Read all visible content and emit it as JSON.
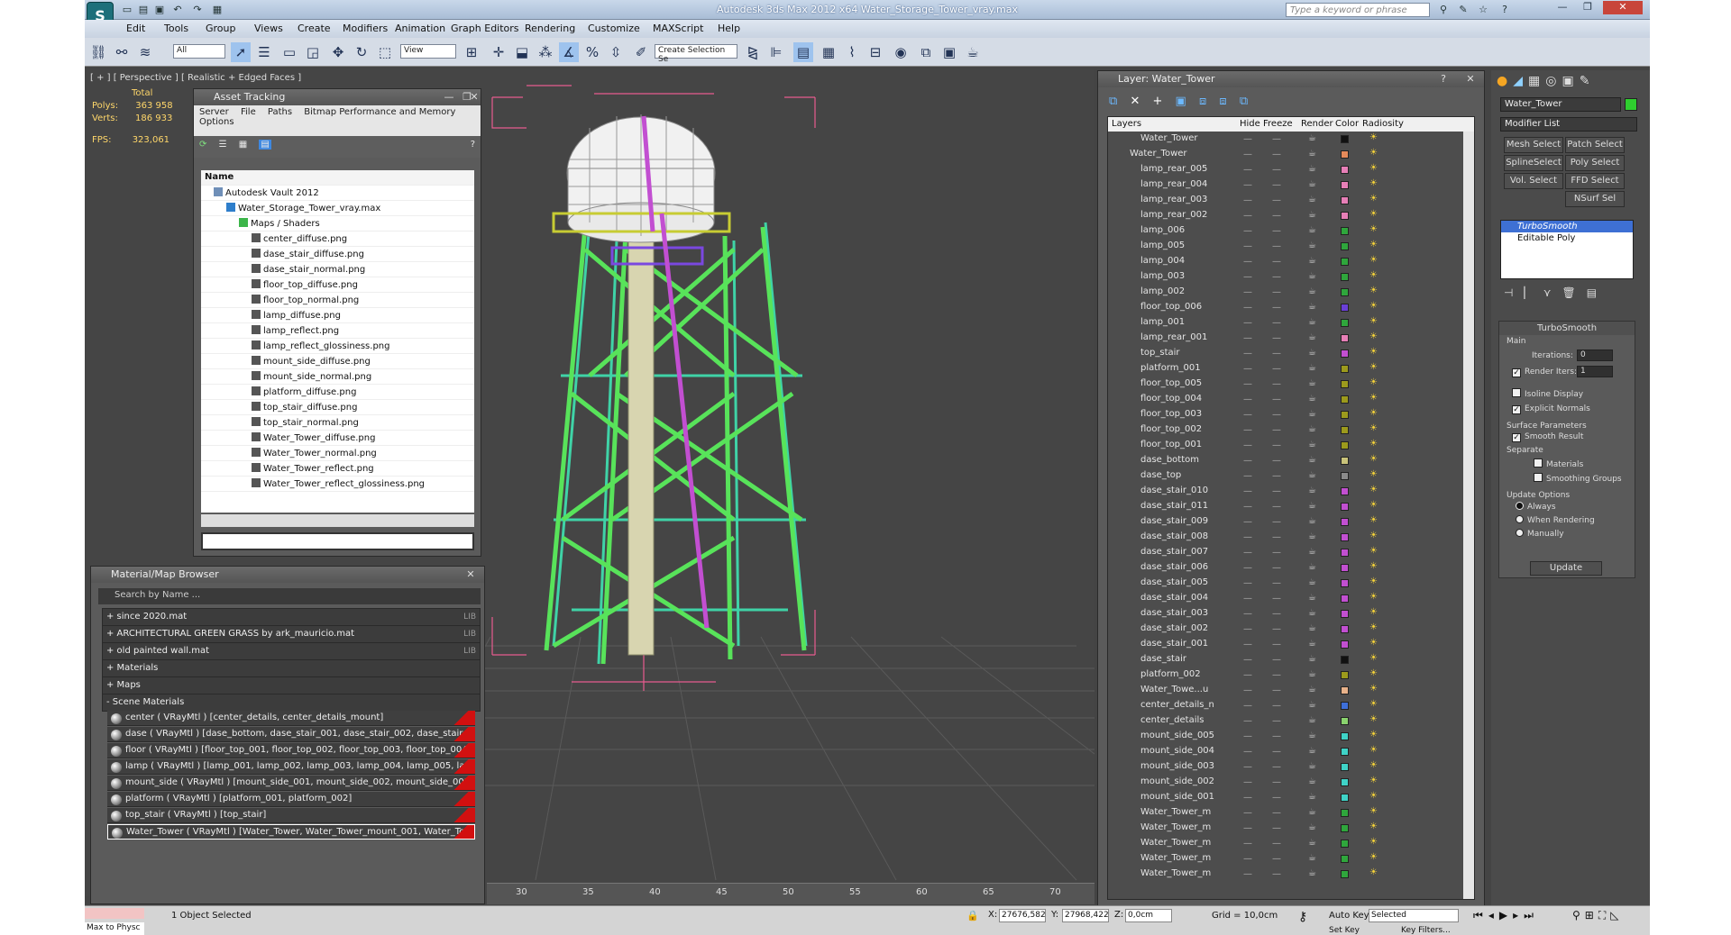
{
  "app": {
    "title": "Autodesk 3ds Max  2012 x64     Water_Storage_Tower_vray.max",
    "search_placeholder": "Type a keyword or phrase"
  },
  "menu": [
    "Edit",
    "Tools",
    "Group",
    "Views",
    "Create",
    "Modifiers",
    "Animation",
    "Graph Editors",
    "Rendering",
    "Customize",
    "MAXScript",
    "Help"
  ],
  "toolbar": {
    "selection_filter": "All",
    "ref_coord": "View",
    "named_selection": "Create Selection Se"
  },
  "viewport": {
    "label": "[ + ] [ Perspective ] [ Realistic + Edged Faces ]",
    "total": "Total",
    "polys_label": "Polys:",
    "polys": "363 958",
    "verts_label": "Verts:",
    "verts": "186 933",
    "fps_label": "FPS:",
    "fps": "323,061"
  },
  "asset_tracking": {
    "title": "Asset Tracking",
    "menu": [
      "Server",
      "File",
      "Paths",
      "Bitmap Performance and Memory",
      "Options"
    ],
    "col": "Name",
    "tree": [
      {
        "name": "Autodesk Vault 2012",
        "indent": 1,
        "type": "vault"
      },
      {
        "name": "Water_Storage_Tower_vray.max",
        "indent": 2,
        "type": "max"
      },
      {
        "name": "Maps / Shaders",
        "indent": 3,
        "type": "folder"
      },
      {
        "name": "center_diffuse.png",
        "indent": 4,
        "type": "file"
      },
      {
        "name": "dase_stair_diffuse.png",
        "indent": 4,
        "type": "file"
      },
      {
        "name": "dase_stair_normal.png",
        "indent": 4,
        "type": "file"
      },
      {
        "name": "floor_top_diffuse.png",
        "indent": 4,
        "type": "file"
      },
      {
        "name": "floor_top_normal.png",
        "indent": 4,
        "type": "file"
      },
      {
        "name": "lamp_diffuse.png",
        "indent": 4,
        "type": "file"
      },
      {
        "name": "lamp_reflect.png",
        "indent": 4,
        "type": "file"
      },
      {
        "name": "lamp_reflect_glossiness.png",
        "indent": 4,
        "type": "file"
      },
      {
        "name": "mount_side_diffuse.png",
        "indent": 4,
        "type": "file"
      },
      {
        "name": "mount_side_normal.png",
        "indent": 4,
        "type": "file"
      },
      {
        "name": "platform_diffuse.png",
        "indent": 4,
        "type": "file"
      },
      {
        "name": "top_stair_diffuse.png",
        "indent": 4,
        "type": "file"
      },
      {
        "name": "top_stair_normal.png",
        "indent": 4,
        "type": "file"
      },
      {
        "name": "Water_Tower_diffuse.png",
        "indent": 4,
        "type": "file"
      },
      {
        "name": "Water_Tower_normal.png",
        "indent": 4,
        "type": "file"
      },
      {
        "name": "Water_Tower_reflect.png",
        "indent": 4,
        "type": "file"
      },
      {
        "name": "Water_Tower_reflect_glossiness.png",
        "indent": 4,
        "type": "file"
      }
    ]
  },
  "material_browser": {
    "title": "Material/Map Browser",
    "search_placeholder": "Search by Name ...",
    "libs": [
      {
        "name": "+ since 2020.mat",
        "tag": "LIB"
      },
      {
        "name": "+ ARCHITECTURAL GREEN GRASS by ark_mauricio.mat",
        "tag": "LIB"
      },
      {
        "name": "+ old painted wall.mat",
        "tag": "LIB"
      },
      {
        "name": "+ Materials",
        "tag": ""
      },
      {
        "name": "+ Maps",
        "tag": ""
      },
      {
        "name": "- Scene Materials",
        "tag": ""
      }
    ],
    "materials": [
      "center  ( VRayMtl ) [center_details, center_details_mount]",
      "dase  ( VRayMtl ) [dase_bottom, dase_stair_001, dase_stair_002, dase_stair_00...",
      "floor  ( VRayMtl ) [floor_top_001, floor_top_002, floor_top_003, floor_top_004, f...",
      "lamp  ( VRayMtl ) [lamp_001, lamp_002, lamp_003, lamp_004, lamp_005, lamp...",
      "mount_side  ( VRayMtl ) [mount_side_001, mount_side_002, mount_side_003,...",
      "platform  ( VRayMtl ) [platform_001, platform_002]",
      "top_stair  ( VRayMtl ) [top_stair]",
      "Water_Tower  ( VRayMtl ) [Water_Tower, Water_Tower_mount_001, Water_To..."
    ]
  },
  "layers": {
    "title": "Layer: Water_Tower",
    "cols": [
      "Layers",
      "Hide",
      "Freeze",
      "Render",
      "Color",
      "Radiosity"
    ],
    "rows": [
      {
        "name": "Water_Tower",
        "color": "#111111",
        "level": 1
      },
      {
        "name": "Water_Tower",
        "color": "#e58a5a",
        "level": 0
      },
      {
        "name": "lamp_rear_005",
        "color": "#e77fb7",
        "level": 1
      },
      {
        "name": "lamp_rear_004",
        "color": "#e77fb7",
        "level": 1
      },
      {
        "name": "lamp_rear_003",
        "color": "#e77fb7",
        "level": 1
      },
      {
        "name": "lamp_rear_002",
        "color": "#e77fb7",
        "level": 1
      },
      {
        "name": "lamp_006",
        "color": "#2fa63c",
        "level": 1
      },
      {
        "name": "lamp_005",
        "color": "#2fa63c",
        "level": 1
      },
      {
        "name": "lamp_004",
        "color": "#2fa63c",
        "level": 1
      },
      {
        "name": "lamp_003",
        "color": "#2fa63c",
        "level": 1
      },
      {
        "name": "lamp_002",
        "color": "#2fa63c",
        "level": 1
      },
      {
        "name": "floor_top_006",
        "color": "#6a3fd6",
        "level": 1
      },
      {
        "name": "lamp_001",
        "color": "#2fa63c",
        "level": 1
      },
      {
        "name": "lamp_rear_001",
        "color": "#e77fb7",
        "level": 1
      },
      {
        "name": "top_stair",
        "color": "#c24fd1",
        "level": 1
      },
      {
        "name": "platform_001",
        "color": "#9c9a1c",
        "level": 1
      },
      {
        "name": "floor_top_005",
        "color": "#9c9a1c",
        "level": 1
      },
      {
        "name": "floor_top_004",
        "color": "#9c9a1c",
        "level": 1
      },
      {
        "name": "floor_top_003",
        "color": "#9c9a1c",
        "level": 1
      },
      {
        "name": "floor_top_002",
        "color": "#9c9a1c",
        "level": 1
      },
      {
        "name": "floor_top_001",
        "color": "#9c9a1c",
        "level": 1
      },
      {
        "name": "dase_bottom",
        "color": "#c9c37a",
        "level": 1
      },
      {
        "name": "dase_top",
        "color": "#8a8a8a",
        "level": 1
      },
      {
        "name": "dase_stair_010",
        "color": "#c24fd1",
        "level": 1
      },
      {
        "name": "dase_stair_011",
        "color": "#c24fd1",
        "level": 1
      },
      {
        "name": "dase_stair_009",
        "color": "#c24fd1",
        "level": 1
      },
      {
        "name": "dase_stair_008",
        "color": "#c24fd1",
        "level": 1
      },
      {
        "name": "dase_stair_007",
        "color": "#c24fd1",
        "level": 1
      },
      {
        "name": "dase_stair_006",
        "color": "#c24fd1",
        "level": 1
      },
      {
        "name": "dase_stair_005",
        "color": "#c24fd1",
        "level": 1
      },
      {
        "name": "dase_stair_004",
        "color": "#c24fd1",
        "level": 1
      },
      {
        "name": "dase_stair_003",
        "color": "#c24fd1",
        "level": 1
      },
      {
        "name": "dase_stair_002",
        "color": "#c24fd1",
        "level": 1
      },
      {
        "name": "dase_stair_001",
        "color": "#c24fd1",
        "level": 1
      },
      {
        "name": "dase_stair",
        "color": "#111111",
        "level": 1
      },
      {
        "name": "platform_002",
        "color": "#9c9a1c",
        "level": 1
      },
      {
        "name": "Water_Towe...u",
        "color": "#e8b28a",
        "level": 1
      },
      {
        "name": "center_details_n",
        "color": "#3e6fd8",
        "level": 1
      },
      {
        "name": "center_details",
        "color": "#8ad36e",
        "level": 1
      },
      {
        "name": "mount_side_005",
        "color": "#3fd3c7",
        "level": 1
      },
      {
        "name": "mount_side_004",
        "color": "#3fd3c7",
        "level": 1
      },
      {
        "name": "mount_side_003",
        "color": "#3fd3c7",
        "level": 1
      },
      {
        "name": "mount_side_002",
        "color": "#3fd3c7",
        "level": 1
      },
      {
        "name": "mount_side_001",
        "color": "#3fd3c7",
        "level": 1
      },
      {
        "name": "Water_Tower_m",
        "color": "#2fa63c",
        "level": 1
      },
      {
        "name": "Water_Tower_m",
        "color": "#2fa63c",
        "level": 1
      },
      {
        "name": "Water_Tower_m",
        "color": "#2fa63c",
        "level": 1
      },
      {
        "name": "Water_Tower_m",
        "color": "#2fa63c",
        "level": 1
      },
      {
        "name": "Water_Tower_m",
        "color": "#2fa63c",
        "level": 1
      }
    ]
  },
  "command_panel": {
    "object_name": "Water_Tower",
    "object_color": "#2fcf2f",
    "modifier_list": "Modifier List",
    "buttons": [
      "Mesh Select",
      "Patch Select",
      "SplineSelect",
      "Poly Select",
      "Vol. Select",
      "FFD Select",
      "NSurf Sel"
    ],
    "stack": [
      "TurboSmooth",
      "Editable Poly"
    ],
    "turbosmooth": {
      "title": "TurboSmooth",
      "main": "Main",
      "iterations_label": "Iterations:",
      "iterations": "0",
      "render_iters_label": "Render Iters:",
      "render_iters": "1",
      "isoline": "Isoline Display",
      "explicit": "Explicit Normals",
      "surface": "Surface Parameters",
      "smooth": "Smooth Result",
      "separate": "Separate",
      "materials": "Materials",
      "smoothing": "Smoothing Groups",
      "update_options": "Update Options",
      "always": "Always",
      "when_rendering": "When Rendering",
      "manually": "Manually",
      "update": "Update"
    }
  },
  "timeline": [
    "30",
    "35",
    "40",
    "45",
    "50",
    "55",
    "60",
    "65",
    "70"
  ],
  "status": {
    "script": "Max to Physc",
    "selected": "1 Object Selected",
    "x_label": "X:",
    "x": "27676,582",
    "y_label": "Y:",
    "y": "27968,422",
    "z_label": "Z:",
    "z": "0,0cm",
    "grid": "Grid = 10,0cm",
    "autokey": "Auto Key",
    "selected_dd": "Selected",
    "setkey": "Set Key",
    "keyfilters": "Key Filters..."
  }
}
